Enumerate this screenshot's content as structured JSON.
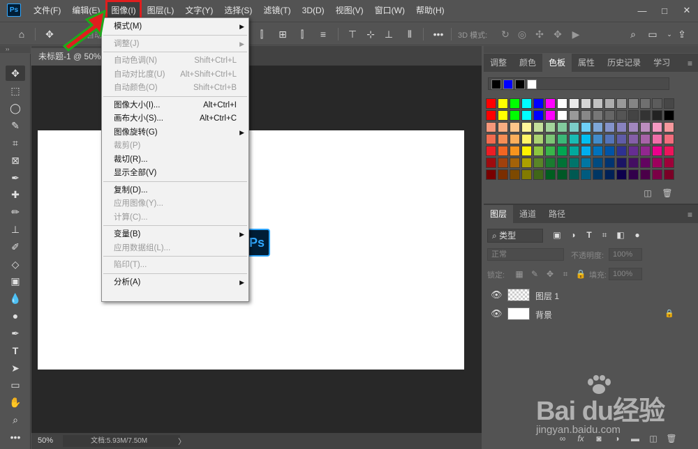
{
  "app": {
    "logo": "Ps"
  },
  "menubar": {
    "items": [
      {
        "label": "文件(F)"
      },
      {
        "label": "编辑(E)"
      },
      {
        "label": "图像(I)"
      },
      {
        "label": "图层(L)"
      },
      {
        "label": "文字(Y)"
      },
      {
        "label": "选择(S)"
      },
      {
        "label": "滤镜(T)"
      },
      {
        "label": "3D(D)"
      },
      {
        "label": "视图(V)"
      },
      {
        "label": "窗口(W)"
      },
      {
        "label": "帮助(H)"
      }
    ],
    "active_index": 2,
    "window_controls": {
      "minimize": "—",
      "restore": "□",
      "close": "✕"
    }
  },
  "optionsbar": {
    "auto_select_label": "自动",
    "mode3d_label": "3D 模式:",
    "more_label": "•••"
  },
  "toolbar": {
    "collapse": "››"
  },
  "document": {
    "tab_title": "未标题-1 @ 50%",
    "canvas_badge": "Ps",
    "zoom": "50%",
    "doc_info": "文档:5.93M/7.50M",
    "arrow": "〉"
  },
  "image_menu": {
    "items": [
      {
        "label": "模式(M)",
        "shortcut": "",
        "submenu": true,
        "disabled": false
      },
      {
        "label": "调整(J)",
        "shortcut": "",
        "submenu": true,
        "disabled": true
      },
      {
        "label": "自动色调(N)",
        "shortcut": "Shift+Ctrl+L",
        "submenu": false,
        "disabled": true
      },
      {
        "label": "自动对比度(U)",
        "shortcut": "Alt+Shift+Ctrl+L",
        "submenu": false,
        "disabled": true
      },
      {
        "label": "自动颜色(O)",
        "shortcut": "Shift+Ctrl+B",
        "submenu": false,
        "disabled": true
      },
      {
        "label": "图像大小(I)...",
        "shortcut": "Alt+Ctrl+I",
        "submenu": false,
        "disabled": false
      },
      {
        "label": "画布大小(S)...",
        "shortcut": "Alt+Ctrl+C",
        "submenu": false,
        "disabled": false
      },
      {
        "label": "图像旋转(G)",
        "shortcut": "",
        "submenu": true,
        "disabled": false
      },
      {
        "label": "裁剪(P)",
        "shortcut": "",
        "submenu": false,
        "disabled": true
      },
      {
        "label": "裁切(R)...",
        "shortcut": "",
        "submenu": false,
        "disabled": false
      },
      {
        "label": "显示全部(V)",
        "shortcut": "",
        "submenu": false,
        "disabled": false
      },
      {
        "label": "复制(D)...",
        "shortcut": "",
        "submenu": false,
        "disabled": false
      },
      {
        "label": "应用图像(Y)...",
        "shortcut": "",
        "submenu": false,
        "disabled": true
      },
      {
        "label": "计算(C)...",
        "shortcut": "",
        "submenu": false,
        "disabled": true
      },
      {
        "label": "变量(B)",
        "shortcut": "",
        "submenu": true,
        "disabled": false
      },
      {
        "label": "应用数据组(L)...",
        "shortcut": "",
        "submenu": false,
        "disabled": true
      },
      {
        "label": "陷印(T)...",
        "shortcut": "",
        "submenu": false,
        "disabled": true
      },
      {
        "label": "分析(A)",
        "shortcut": "",
        "submenu": true,
        "disabled": false
      }
    ]
  },
  "swatches_panel": {
    "tabs": [
      "调整",
      "颜色",
      "色板",
      "属性",
      "历史记录",
      "学习"
    ],
    "active_tab": 2,
    "recent": [
      "#000000",
      "#0000ff",
      "#000000",
      "#ffffff"
    ],
    "rows": [
      [
        "#ff0000",
        "#ffff00",
        "#00ff00",
        "#00ffff",
        "#0000ff",
        "#ff00ff",
        "#ffffff",
        "#ebebeb",
        "#d6d6d6",
        "#c2c2c2",
        "#adadad",
        "#999999",
        "#858585",
        "#707070",
        "#5c5c5c",
        "#474747"
      ],
      [
        "#ff0000",
        "#ffff00",
        "#00ff00",
        "#00ffff",
        "#0000ff",
        "#ff00ff",
        "#ffffff",
        "#9a9a9a",
        "#888888",
        "#777777",
        "#666666",
        "#555555",
        "#444444",
        "#333333",
        "#222222",
        "#000000"
      ],
      [
        "#f7977a",
        "#f9ad81",
        "#fdc68a",
        "#fff79a",
        "#c4df9b",
        "#a3d39c",
        "#82ca9d",
        "#7bcdc8",
        "#6ecff6",
        "#7ea7d8",
        "#8493ca",
        "#8882be",
        "#a187be",
        "#bc8dbf",
        "#f49ac2",
        "#f6989d"
      ],
      [
        "#f26c4f",
        "#f68e55",
        "#fbaf5c",
        "#fff467",
        "#acd372",
        "#7cc576",
        "#3bb878",
        "#1abbb4",
        "#00bff3",
        "#438cca",
        "#5574b9",
        "#605ca8",
        "#855fa8",
        "#a763a8",
        "#f06ea9",
        "#f26d7d"
      ],
      [
        "#ed1c24",
        "#f26522",
        "#f7941d",
        "#fff200",
        "#8dc63f",
        "#39b54a",
        "#00a651",
        "#00a99d",
        "#00aeef",
        "#0072bc",
        "#0054a6",
        "#2e3192",
        "#662d91",
        "#92278f",
        "#ec008c",
        "#ed145b"
      ],
      [
        "#9e0b0f",
        "#a0410d",
        "#a36209",
        "#aba000",
        "#598527",
        "#1a7b30",
        "#007236",
        "#00746b",
        "#0076a3",
        "#004b80",
        "#003471",
        "#1b1464",
        "#440e62",
        "#630460",
        "#9e005d",
        "#9e0039"
      ],
      [
        "#790000",
        "#7b2e00",
        "#7d4900",
        "#827b00",
        "#406618",
        "#005e20",
        "#005826",
        "#005952",
        "#005b7f",
        "#003663",
        "#002157",
        "#0d004c",
        "#32004b",
        "#4b0049",
        "#7b0046",
        "#7a0026"
      ]
    ]
  },
  "layers_panel": {
    "tabs": [
      "图层",
      "通道",
      "路径"
    ],
    "active_tab": 0,
    "filter_label": "类型",
    "blend_mode": "正常",
    "opacity_label": "不透明度:",
    "opacity_value": "100%",
    "lock_label": "锁定:",
    "fill_label": "填充:",
    "fill_value": "100%",
    "layers": [
      {
        "name": "图层 1",
        "selected": false,
        "locked": false
      },
      {
        "name": "背景",
        "selected": false,
        "locked": true
      }
    ],
    "footer": {
      "link": "∞",
      "fx": "fx"
    }
  },
  "watermark": {
    "brand": "Bai du经验",
    "url": "jingyan.baidu.com"
  }
}
